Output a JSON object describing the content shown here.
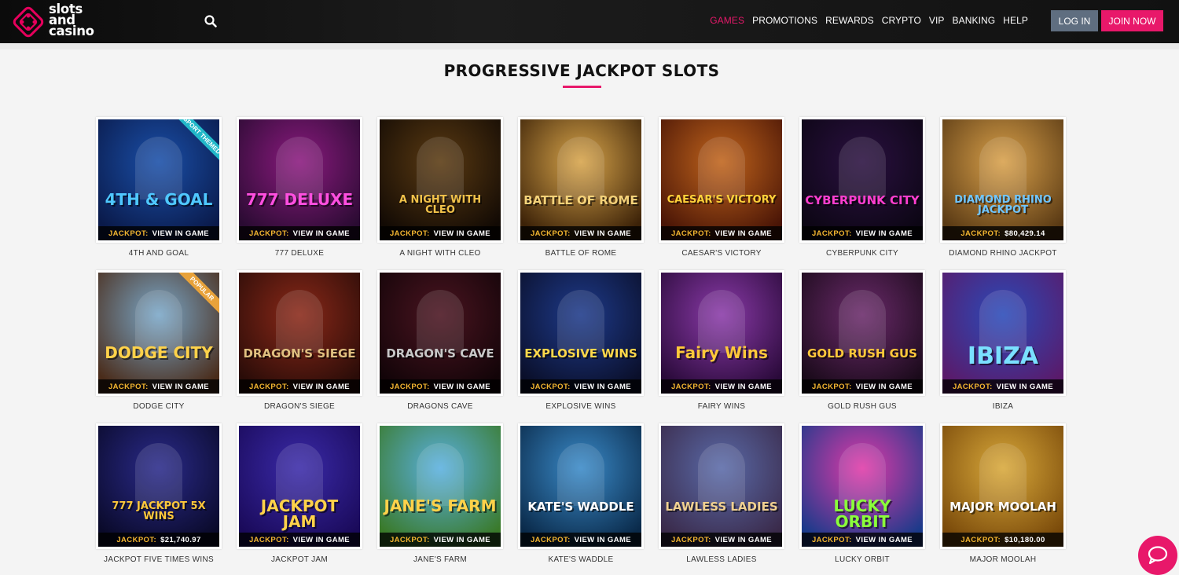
{
  "header": {
    "logo_lines": [
      "slots",
      "and",
      "casino"
    ],
    "nav": [
      "GAMES",
      "PROMOTIONS",
      "REWARDS",
      "CRYPTO",
      "VIP",
      "BANKING",
      "HELP"
    ],
    "active_nav": "GAMES",
    "login_label": "LOG IN",
    "join_label": "JOIN NOW"
  },
  "page_title": "PROGRESSIVE JACKPOT SLOTS",
  "jackpot_label": "JACKPOT:",
  "games": [
    {
      "name": "4TH AND GOAL",
      "jackpot": "VIEW IN GAME",
      "art_text": "4TH & GOAL",
      "ribbon": "SPORT THEMED",
      "ribbon_color": "#22b8c9",
      "colors": [
        "#1a4fa8",
        "#0a1a4a"
      ],
      "text_color": "#4fc8ff"
    },
    {
      "name": "777 DELUXE",
      "jackpot": "VIEW IN GAME",
      "art_text": "777 DELUXE",
      "colors": [
        "#8a1a7e",
        "#2a0b32"
      ],
      "text_color": "#ff4fe0"
    },
    {
      "name": "A NIGHT WITH CLEO",
      "jackpot": "VIEW IN GAME",
      "art_text": "A NIGHT WITH CLEO",
      "colors": [
        "#5a3a12",
        "#120a04"
      ],
      "text_color": "#f1c24a"
    },
    {
      "name": "BATTLE OF ROME",
      "jackpot": "VIEW IN GAME",
      "art_text": "BATTLE OF ROME",
      "colors": [
        "#d7a44a",
        "#3c2208"
      ],
      "text_color": "#f4d27a"
    },
    {
      "name": "CAESAR'S VICTORY",
      "jackpot": "VIEW IN GAME",
      "art_text": "CAESAR'S VICTORY",
      "colors": [
        "#c0641c",
        "#4a1506"
      ],
      "text_color": "#ffd23a"
    },
    {
      "name": "CYBERPUNK CITY",
      "jackpot": "VIEW IN GAME",
      "art_text": "CYBERPUNK CITY",
      "colors": [
        "#2a1040",
        "#0c0614"
      ],
      "text_color": "#ff3ecf"
    },
    {
      "name": "DIAMOND RHINO JACKPOT",
      "jackpot": "$80,429.14",
      "art_text": "DIAMOND RHINO JACKPOT",
      "colors": [
        "#d8a04a",
        "#5a3a14"
      ],
      "text_color": "#6fc6ff"
    },
    {
      "name": "DODGE CITY",
      "jackpot": "VIEW IN GAME",
      "art_text": "DODGE CITY",
      "ribbon": "POPULAR",
      "ribbon_color": "#e8a23a",
      "colors": [
        "#7aa7c8",
        "#4a2c1a"
      ],
      "text_color": "#ffd24a"
    },
    {
      "name": "DRAGON'S SIEGE",
      "jackpot": "VIEW IN GAME",
      "art_text": "DRAGON'S SIEGE",
      "colors": [
        "#8a2818",
        "#2a0c08"
      ],
      "text_color": "#e0c080"
    },
    {
      "name": "DRAGONS CAVE",
      "jackpot": "VIEW IN GAME",
      "art_text": "DRAGON'S CAVE",
      "colors": [
        "#4a1420",
        "#120408"
      ],
      "text_color": "#c8c8c8"
    },
    {
      "name": "EXPLOSIVE WINS",
      "jackpot": "VIEW IN GAME",
      "art_text": "EXPLOSIVE WINS",
      "colors": [
        "#1e3a8a",
        "#0a0f2a"
      ],
      "text_color": "#ffd84a"
    },
    {
      "name": "FAIRY WINS",
      "jackpot": "VIEW IN GAME",
      "art_text": "Fairy Wins",
      "colors": [
        "#8a3aa8",
        "#2a0a3a"
      ],
      "text_color": "#ffc83a"
    },
    {
      "name": "GOLD RUSH GUS",
      "jackpot": "VIEW IN GAME",
      "art_text": "GOLD RUSH GUS",
      "colors": [
        "#6a2a6a",
        "#1a0a1a"
      ],
      "text_color": "#ffc83a"
    },
    {
      "name": "IBIZA",
      "jackpot": "VIEW IN GAME",
      "art_text": "IBIZA",
      "colors": [
        "#2a4ab8",
        "#5a1a6a"
      ],
      "text_color": "#7ae0ff"
    },
    {
      "name": "JACKPOT FIVE TIMES WINS",
      "jackpot": "$21,740.97",
      "art_text": "777 JACKPOT 5X WINS",
      "colors": [
        "#2a2a8a",
        "#0a0a2a"
      ],
      "text_color": "#ffc83a"
    },
    {
      "name": "JACKPOT JAM",
      "jackpot": "VIEW IN GAME",
      "art_text": "JACKPOT JAM",
      "colors": [
        "#3a2aa8",
        "#1a0a5a"
      ],
      "text_color": "#ffd24a"
    },
    {
      "name": "JANE'S FARM",
      "jackpot": "VIEW IN GAME",
      "art_text": "JANE'S FARM",
      "colors": [
        "#5ab0e0",
        "#3a7a2a"
      ],
      "text_color": "#ffd24a"
    },
    {
      "name": "KATE'S WADDLE",
      "jackpot": "VIEW IN GAME",
      "art_text": "KATE'S WADDLE",
      "colors": [
        "#3a8ac8",
        "#0a2a4a"
      ],
      "text_color": "#ffffff"
    },
    {
      "name": "LAWLESS LADIES",
      "jackpot": "VIEW IN GAME",
      "art_text": "LAWLESS LADIES",
      "colors": [
        "#5a6aa8",
        "#3a2a4a"
      ],
      "text_color": "#f0d090"
    },
    {
      "name": "LUCKY ORBIT",
      "jackpot": "VIEW IN GAME",
      "art_text": "LUCKY ORBIT",
      "colors": [
        "#e03aa8",
        "#1a3a8a"
      ],
      "text_color": "#8aff3a"
    },
    {
      "name": "MAJOR MOOLAH",
      "jackpot": "$10,180.00",
      "art_text": "MAJOR MOOLAH",
      "colors": [
        "#d8a83a",
        "#7a4a0a"
      ],
      "text_color": "#ffffff"
    }
  ],
  "colors": {
    "accent": "#e8186a",
    "jackpot_label": "#f2b530",
    "login_bg": "#5f6e80",
    "header_bg": "#111111"
  },
  "chat_icon": "chat-bubble-icon"
}
